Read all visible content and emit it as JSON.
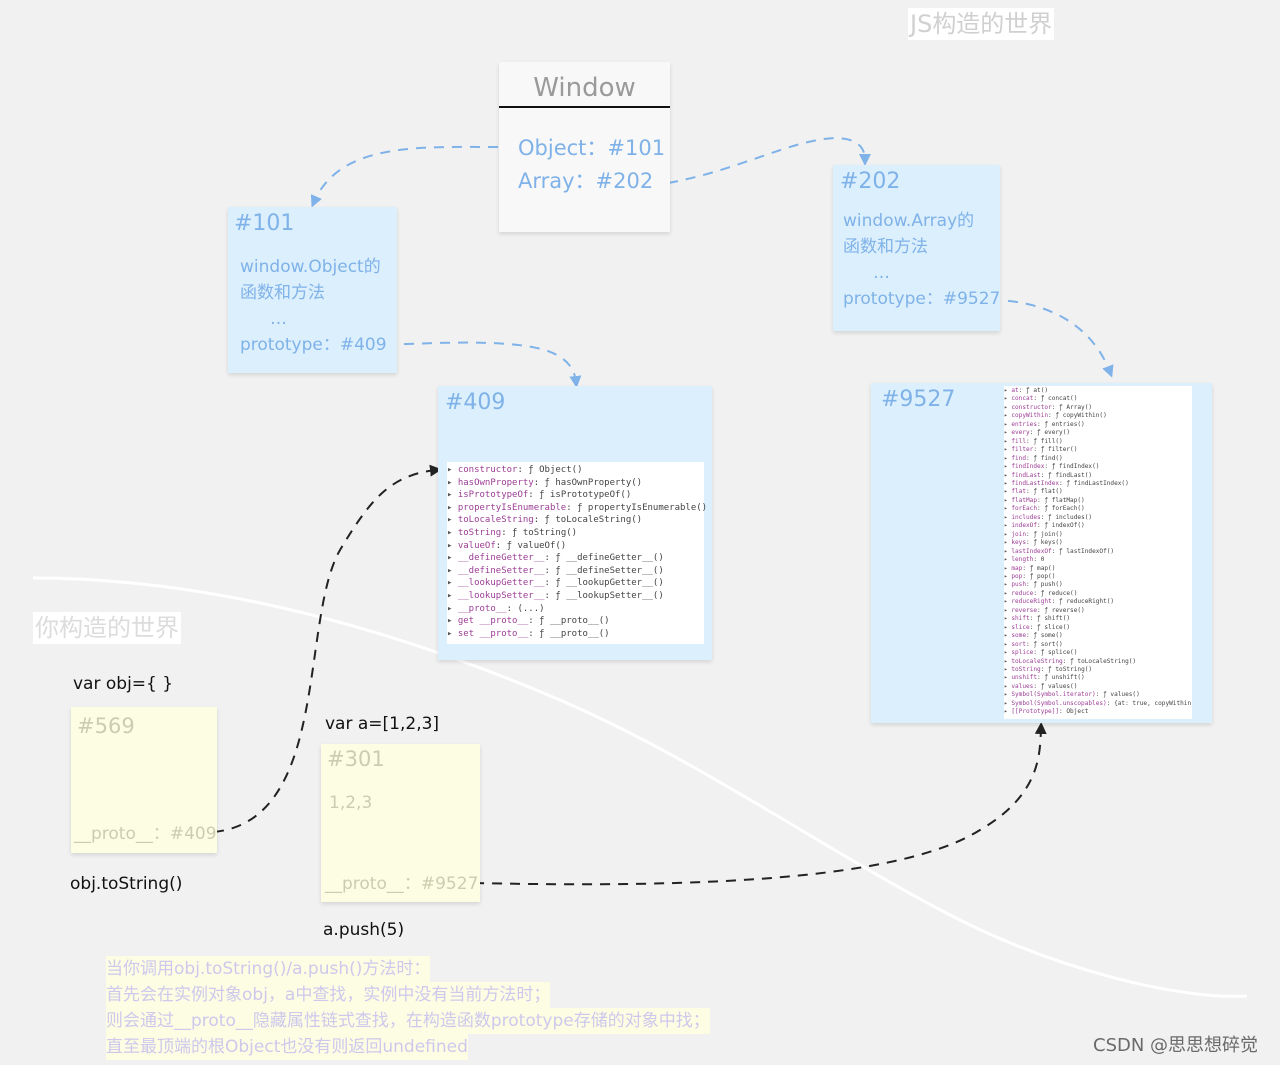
{
  "js_world_title": "JS构造的世界",
  "your_world_title": "你构造的世界",
  "window_box": {
    "title": "Window",
    "object_ref": "Object：#101",
    "array_ref": "Array：#202"
  },
  "box_101": {
    "id": "#101",
    "desc_line1": "window.Object的",
    "desc_line2": "函数和方法",
    "ellipsis": "…",
    "prototype": "prototype：#409"
  },
  "box_202": {
    "id": "#202",
    "desc_line1": "window.Array的",
    "desc_line2": "函数和方法",
    "ellipsis": "…",
    "prototype": "prototype：#9527"
  },
  "box_409": {
    "id": "#409",
    "members": [
      {
        "key": "constructor",
        "val": "ƒ Object()"
      },
      {
        "key": "hasOwnProperty",
        "val": "ƒ hasOwnProperty()"
      },
      {
        "key": "isPrototypeOf",
        "val": "ƒ isPrototypeOf()"
      },
      {
        "key": "propertyIsEnumerable",
        "val": "ƒ propertyIsEnumerable()"
      },
      {
        "key": "toLocaleString",
        "val": "ƒ toLocaleString()"
      },
      {
        "key": "toString",
        "val": "ƒ toString()"
      },
      {
        "key": "valueOf",
        "val": "ƒ valueOf()"
      },
      {
        "key": "__defineGetter__",
        "val": "ƒ __defineGetter__()"
      },
      {
        "key": "__defineSetter__",
        "val": "ƒ __defineSetter__()"
      },
      {
        "key": "__lookupGetter__",
        "val": "ƒ __lookupGetter__()"
      },
      {
        "key": "__lookupSetter__",
        "val": "ƒ __lookupSetter__()"
      },
      {
        "key": "__proto__",
        "val": "(...)"
      },
      {
        "key": "get __proto__",
        "val": "ƒ __proto__()"
      },
      {
        "key": "set __proto__",
        "val": "ƒ __proto__()"
      }
    ]
  },
  "box_9527": {
    "id": "#9527",
    "members": [
      {
        "key": "at",
        "val": "ƒ at()"
      },
      {
        "key": "concat",
        "val": "ƒ concat()"
      },
      {
        "key": "constructor",
        "val": "ƒ Array()"
      },
      {
        "key": "copyWithin",
        "val": "ƒ copyWithin()"
      },
      {
        "key": "entries",
        "val": "ƒ entries()"
      },
      {
        "key": "every",
        "val": "ƒ every()"
      },
      {
        "key": "fill",
        "val": "ƒ fill()"
      },
      {
        "key": "filter",
        "val": "ƒ filter()"
      },
      {
        "key": "find",
        "val": "ƒ find()"
      },
      {
        "key": "findIndex",
        "val": "ƒ findIndex()"
      },
      {
        "key": "findLast",
        "val": "ƒ findLast()"
      },
      {
        "key": "findLastIndex",
        "val": "ƒ findLastIndex()"
      },
      {
        "key": "flat",
        "val": "ƒ flat()"
      },
      {
        "key": "flatMap",
        "val": "ƒ flatMap()"
      },
      {
        "key": "forEach",
        "val": "ƒ forEach()"
      },
      {
        "key": "includes",
        "val": "ƒ includes()"
      },
      {
        "key": "indexOf",
        "val": "ƒ indexOf()"
      },
      {
        "key": "join",
        "val": "ƒ join()"
      },
      {
        "key": "keys",
        "val": "ƒ keys()"
      },
      {
        "key": "lastIndexOf",
        "val": "ƒ lastIndexOf()"
      },
      {
        "key": "length",
        "val": "0"
      },
      {
        "key": "map",
        "val": "ƒ map()"
      },
      {
        "key": "pop",
        "val": "ƒ pop()"
      },
      {
        "key": "push",
        "val": "ƒ push()"
      },
      {
        "key": "reduce",
        "val": "ƒ reduce()"
      },
      {
        "key": "reduceRight",
        "val": "ƒ reduceRight()"
      },
      {
        "key": "reverse",
        "val": "ƒ reverse()"
      },
      {
        "key": "shift",
        "val": "ƒ shift()"
      },
      {
        "key": "slice",
        "val": "ƒ slice()"
      },
      {
        "key": "some",
        "val": "ƒ some()"
      },
      {
        "key": "sort",
        "val": "ƒ sort()"
      },
      {
        "key": "splice",
        "val": "ƒ splice()"
      },
      {
        "key": "toLocaleString",
        "val": "ƒ toLocaleString()"
      },
      {
        "key": "toString",
        "val": "ƒ toString()"
      },
      {
        "key": "unshift",
        "val": "ƒ unshift()"
      },
      {
        "key": "values",
        "val": "ƒ values()"
      },
      {
        "key": "Symbol(Symbol.iterator)",
        "val": "ƒ values()"
      },
      {
        "key": "Symbol(Symbol.unscopables)",
        "val": "{at: true, copyWithin"
      },
      {
        "key": "[[Prototype]]",
        "val": "Object"
      }
    ]
  },
  "obj_decl": "var obj={ }",
  "obj_call": "obj.toString()",
  "box_569": {
    "id": "#569",
    "proto": "__proto__：#409"
  },
  "arr_decl": "var a=[1,2,3]",
  "arr_call": "a.push(5)",
  "box_301": {
    "id": "#301",
    "values": "1,2,3",
    "proto": "__proto__：#9527"
  },
  "note_lines": [
    "当你调用obj.toString()/a.push()方法时：",
    "首先会在实例对象obj，a中查找，实例中没有当前方法时；",
    "则会通过__proto__隐藏属性链式查找，在构造函数prototype存储的对象中找；",
    "直至最顶端的根Object也没有则返回undefined"
  ],
  "watermark": "CSDN @思思想碎觉",
  "colors": {
    "blue_box": "#dceffc",
    "blue_text": "#7fb2e8",
    "yellow_box": "#fcfde3",
    "background": "#f1f1f1"
  }
}
